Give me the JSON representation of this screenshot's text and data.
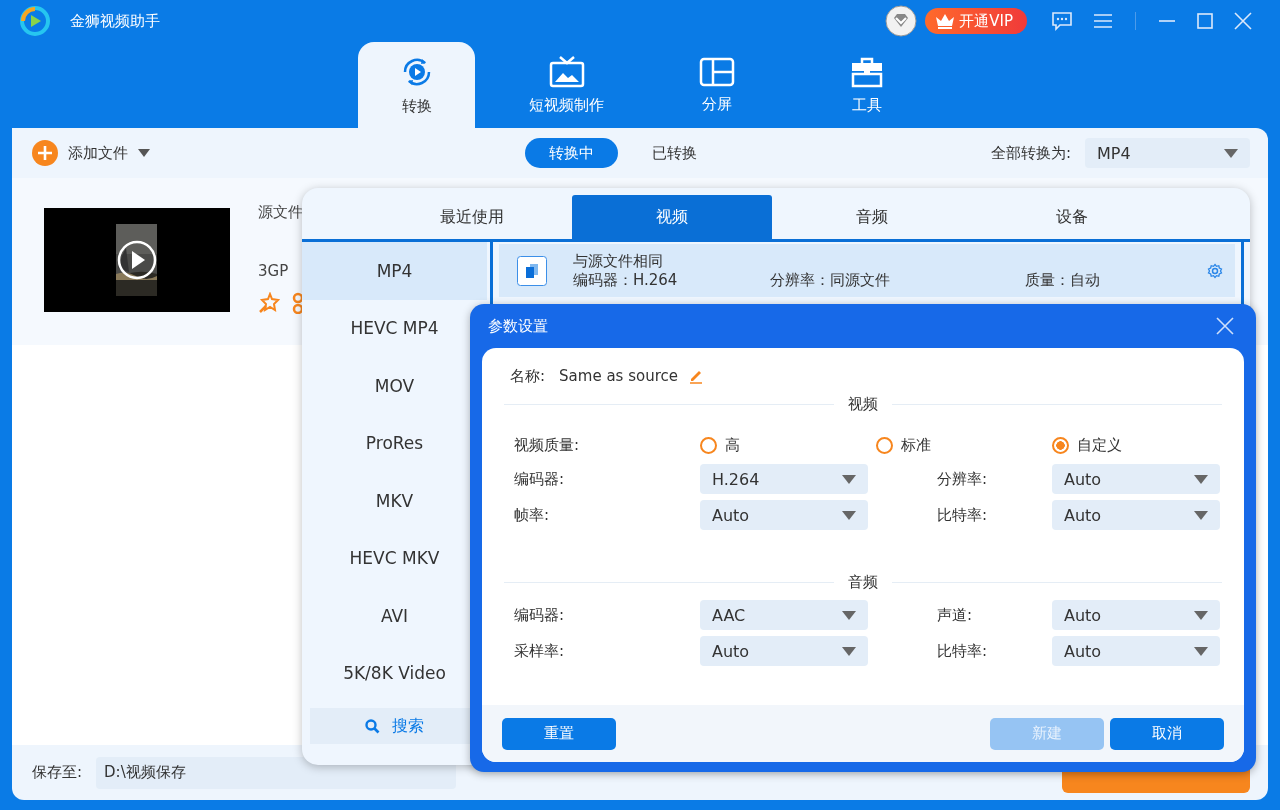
{
  "titlebar": {
    "title": "金狮视频助手",
    "vip_button": "开通VIP"
  },
  "nav_tabs": [
    {
      "label": "转换",
      "selected": true
    },
    {
      "label": "短视频制作",
      "selected": false
    },
    {
      "label": "分屏",
      "selected": false
    },
    {
      "label": "工具",
      "selected": false
    }
  ],
  "toolbar": {
    "add_file": "添加文件",
    "status_tabs": [
      {
        "label": "转换中",
        "selected": true
      },
      {
        "label": "已转换",
        "selected": false
      }
    ],
    "convert_all_label": "全部转换为:",
    "convert_all_value": "MP4"
  },
  "file_row": {
    "name": "源文件",
    "format": "3GP"
  },
  "save_bar": {
    "label": "保存至:",
    "path": "D:\\视频保存"
  },
  "format_popup": {
    "tabs": [
      {
        "label": "最近使用",
        "selected": false
      },
      {
        "label": "视频",
        "selected": true
      },
      {
        "label": "音频",
        "selected": false
      },
      {
        "label": "设备",
        "selected": false
      }
    ],
    "formats": [
      {
        "label": "MP4",
        "selected": true
      },
      {
        "label": "HEVC MP4",
        "selected": false
      },
      {
        "label": "MOV",
        "selected": false
      },
      {
        "label": "ProRes",
        "selected": false
      },
      {
        "label": "MKV",
        "selected": false
      },
      {
        "label": "HEVC MKV",
        "selected": false
      },
      {
        "label": "AVI",
        "selected": false
      },
      {
        "label": "5K/8K Video",
        "selected": false
      }
    ],
    "search_button": "搜索",
    "presets": [
      {
        "name": "与源文件相同",
        "encoder": "编码器：H.264",
        "resolution": "分辨率：同源文件",
        "quality": "质量：自动",
        "selected": true
      }
    ]
  },
  "settings_dialog": {
    "title": "参数设置",
    "name_label": "名称:",
    "name_value": "Same as source",
    "video": {
      "title": "视频",
      "quality_label": "视频质量:",
      "quality_options": [
        {
          "label": "高",
          "selected": false
        },
        {
          "label": "标准",
          "selected": false
        },
        {
          "label": "自定义",
          "selected": true
        }
      ],
      "fields": [
        {
          "label": "编码器:",
          "value": "H.264"
        },
        {
          "label": "分辨率:",
          "value": "Auto"
        },
        {
          "label": "帧率:",
          "value": "Auto"
        },
        {
          "label": "比特率:",
          "value": "Auto"
        }
      ]
    },
    "audio": {
      "title": "音频",
      "fields": [
        {
          "label": "编码器:",
          "value": "AAC"
        },
        {
          "label": "声道:",
          "value": "Auto"
        },
        {
          "label": "采样率:",
          "value": "Auto"
        },
        {
          "label": "比特率:",
          "value": "Auto"
        }
      ]
    },
    "buttons": [
      {
        "label": "重置",
        "kind": "reset",
        "disabled": false
      },
      {
        "label": "新建",
        "kind": "primary",
        "disabled": true
      },
      {
        "label": "取消",
        "kind": "primary",
        "disabled": false
      }
    ]
  }
}
